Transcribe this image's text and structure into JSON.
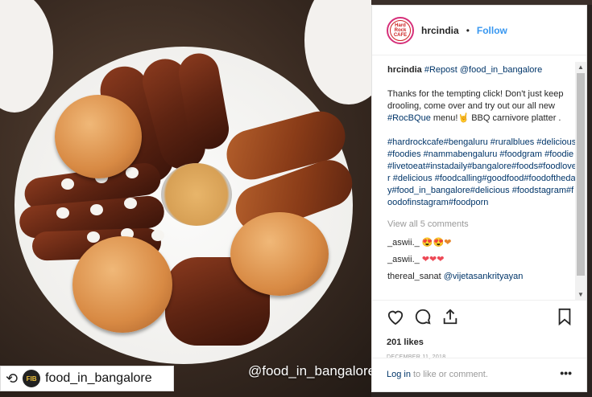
{
  "photo": {
    "watermark": "@food_in_bangalore",
    "repost_badge": {
      "icon": "repost-icon",
      "avatar_text": "FIB",
      "username": "food_in_bangalore"
    }
  },
  "header": {
    "avatar_text": "Hard Rock CAFE",
    "username": "hrcindia",
    "separator": "•",
    "follow_label": "Follow"
  },
  "caption": {
    "username": "hrcindia",
    "repost": "#Repost @food_in_bangalore",
    "body": "Thanks for the tempting click! Don't just keep drooling, come over and try out our all new",
    "hashtag_menu": "#RocBQue",
    "body2": "menu!🤘 BBQ carnivore platter .",
    "hashtags": "#hardrockcafe#bengaluru #ruralblues #delicious #foodies #nammabengaluru #foodgram #foodie#livetoeat#instadaily#bangalore#foods#foodlover #delicious #foodcalling#goodfood#foodoftheday#food_in_bangalore#delicious #foodstagram#foodofinstagram#foodporn"
  },
  "view_all": "View all 5 comments",
  "comments": [
    {
      "user": "_aswii._",
      "text": "😍😍❤"
    },
    {
      "user": "_aswii._",
      "text": "❤❤❤"
    },
    {
      "user": "thereal_sanat",
      "text": "@vijetasankrityayan"
    }
  ],
  "likes": "201 likes",
  "date": "DECEMBER 11, 2018",
  "login": {
    "link": "Log in",
    "text": "to like or comment.",
    "more": "•••"
  },
  "colors": {
    "follow": "#3897f0",
    "hashtag": "#003569",
    "heart": "#ed4956"
  }
}
